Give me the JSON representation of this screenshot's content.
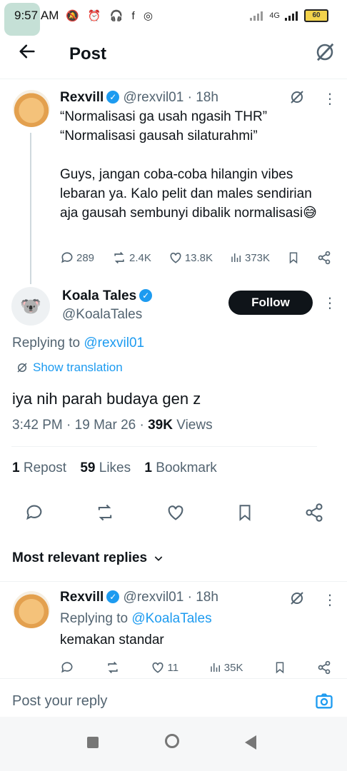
{
  "status_bar": {
    "time": "9:57 AM",
    "notif_icons": "🔕 ⏰ 🎧 f ◎",
    "network": "4G",
    "battery": "60"
  },
  "header": {
    "title": "Post"
  },
  "parent_tweet": {
    "name": "Rexvill",
    "handle": "@rexvil01 · 18h",
    "text1": "“Normalisasi ga usah ngasih THR”",
    "text2": "“Normalisasi gausah silaturahmi”",
    "text3": "Guys, jangan coba-coba hilangin vibes lebaran ya. Kalo pelit dan males sendirian aja gausah sembunyi dibalik normalisasi😅",
    "replies": "289",
    "reposts": "2.4K",
    "likes": "13.8K",
    "views": "373K"
  },
  "main_tweet": {
    "name": "Koala Tales",
    "handle": "@KoalaTales",
    "follow": "Follow",
    "replying_prefix": "Replying to",
    "replying_to": "@rexvil01",
    "show_translation": "Show translation",
    "text": "iya nih parah budaya gen z",
    "time": "3:42 PM",
    "date": "19 Mar 26",
    "views_count": "39K",
    "views_label": "Views",
    "repost_count": "1",
    "repost_label": "Repost",
    "likes_count": "59",
    "likes_label": "Likes",
    "bookmark_count": "1",
    "bookmark_label": "Bookmark"
  },
  "replies_header": "Most relevant replies",
  "reply": {
    "name": "Rexvill",
    "handle": "@rexvil01 · 18h",
    "replying_prefix": "Replying to",
    "replying_to": "@KoalaTales",
    "text": "kemakan standar",
    "likes": "11",
    "views": "35K"
  },
  "composer": {
    "placeholder": "Post your reply"
  }
}
